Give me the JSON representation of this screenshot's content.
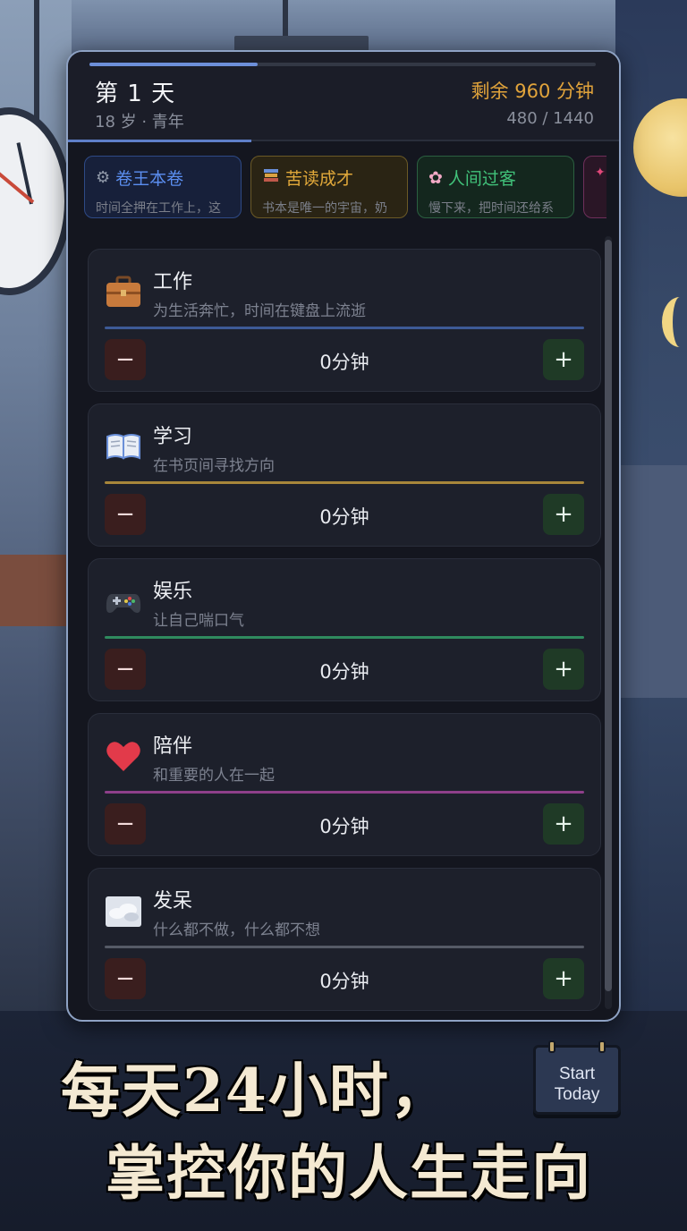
{
  "header": {
    "day_title": "第 1 天",
    "age_line": "18 岁 · 青年",
    "remaining": "剩余 960 分钟",
    "time_ratio": "480 / 1440",
    "day_progress": 0.333
  },
  "presets": [
    {
      "title": "卷王本卷",
      "desc": "时间全押在工作上，这",
      "icon": "gear-icon",
      "color": "#5b8ef0"
    },
    {
      "title": "苦读成才",
      "desc": "书本是唯一的宇宙，奶",
      "icon": "books-icon",
      "color": "#e0a83a"
    },
    {
      "title": "人间过客",
      "desc": "慢下来，把时间还给系",
      "icon": "flower-icon",
      "color": "#41c27a"
    },
    {
      "title": "",
      "desc": "",
      "icon": "rose-icon",
      "color": "#d05a9a"
    }
  ],
  "activities": [
    {
      "title": "工作",
      "desc": "为生活奔忙，时间在键盘上流逝",
      "value": "0分钟",
      "icon": "briefcase-icon",
      "bar_color": "#3d5a96"
    },
    {
      "title": "学习",
      "desc": "在书页间寻找方向",
      "value": "0分钟",
      "icon": "book-icon",
      "bar_color": "#a8863a"
    },
    {
      "title": "娱乐",
      "desc": "让自己喘口气",
      "value": "0分钟",
      "icon": "gamepad-icon",
      "bar_color": "#2f8a5e"
    },
    {
      "title": "陪伴",
      "desc": "和重要的人在一起",
      "value": "0分钟",
      "icon": "heart-icon",
      "bar_color": "#8e3f8a"
    },
    {
      "title": "发呆",
      "desc": "什么都不做，什么都不想",
      "value": "0分钟",
      "icon": "cloud-icon",
      "bar_color": "#555a66"
    }
  ],
  "controls": {
    "minus": "−",
    "plus": "+"
  },
  "banner": {
    "line1": "每天24小时，",
    "line2": "掌控你的人生走向"
  },
  "start_button": {
    "line1": "Start",
    "line2": "Today"
  }
}
